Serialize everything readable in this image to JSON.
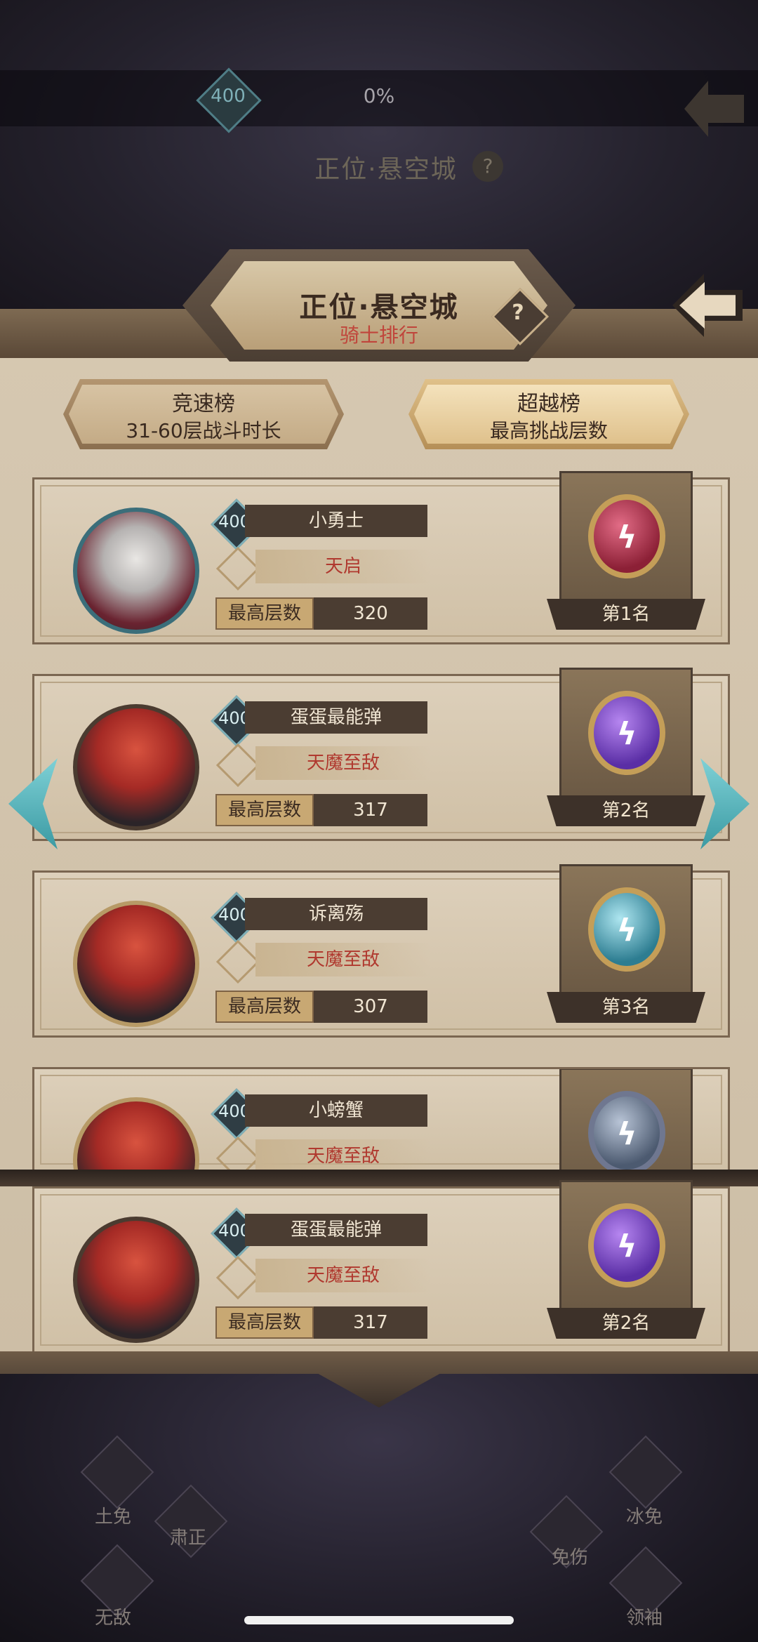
{
  "top_bar": {
    "level": "400",
    "progress": "0%",
    "faded_title": "正位·悬空城",
    "faded_help": "?"
  },
  "header": {
    "title": "正位·悬空城",
    "subtitle": "骑士排行",
    "help": "?"
  },
  "tabs": [
    {
      "title": "竞速榜",
      "subtitle": "31-60层战斗时长",
      "selected": false
    },
    {
      "title": "超越榜",
      "subtitle": "最高挑战层数",
      "selected": true
    }
  ],
  "ranking": [
    {
      "level": "400",
      "name": "小勇士",
      "title": "天启",
      "floor_label": "最高层数",
      "floor": "320",
      "rank": "第1名",
      "medal": "red",
      "avatar": "knight"
    },
    {
      "level": "400",
      "name": "蛋蛋最能弹",
      "title": "天魔至敌",
      "floor_label": "最高层数",
      "floor": "317",
      "rank": "第2名",
      "medal": "purple",
      "avatar": "red-hair"
    },
    {
      "level": "400",
      "name": "诉离殇",
      "title": "天魔至敌",
      "floor_label": "最高层数",
      "floor": "307",
      "rank": "第3名",
      "medal": "cyan",
      "avatar": "red-hair"
    },
    {
      "level": "400",
      "name": "小螃蟹",
      "title": "天魔至敌",
      "medal": "slate",
      "avatar": "red-hair"
    }
  ],
  "self_entry": {
    "level": "400",
    "name": "蛋蛋最能弹",
    "title": "天魔至敌",
    "floor_label": "最高层数",
    "floor": "317",
    "rank": "第2名",
    "medal": "purple",
    "avatar": "red-hair"
  },
  "bottom_skills": {
    "earth_immune": "土免",
    "solemn": "肃正",
    "invincible": "无敌",
    "ice_immune": "冰免",
    "damage_immune": "免伤",
    "leader": "领袖"
  },
  "icons": {
    "back": "back-arrow-icon",
    "prev": "chevron-left-icon",
    "next": "chevron-right-icon",
    "help": "help-icon",
    "title_badge": "title-emblem-icon",
    "level_badge": "level-diamond-icon"
  },
  "colors": {
    "accent_red": "#c0453b",
    "teal": "#7fd1d6",
    "panel": "#d6c8b1"
  }
}
